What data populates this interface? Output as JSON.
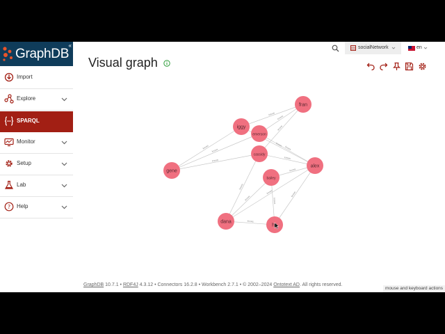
{
  "brand": {
    "name": "GraphDB"
  },
  "sidebar": {
    "items": [
      {
        "label": "Import",
        "icon": "import-icon",
        "has_chevron": false
      },
      {
        "label": "Explore",
        "icon": "explore-icon",
        "has_chevron": true
      },
      {
        "label": "SPARQL",
        "icon": "sparql-icon",
        "has_chevron": false,
        "active": true
      },
      {
        "label": "Monitor",
        "icon": "monitor-icon",
        "has_chevron": true
      },
      {
        "label": "Setup",
        "icon": "gear-icon",
        "has_chevron": true
      },
      {
        "label": "Lab",
        "icon": "flask-icon",
        "has_chevron": true
      },
      {
        "label": "Help",
        "icon": "help-icon",
        "has_chevron": true
      }
    ]
  },
  "header": {
    "title": "Visual graph",
    "repository": "socialNetwork",
    "language": "en"
  },
  "graph": {
    "node_color": "#f07080",
    "edge_color": "#c8c8c8",
    "nodes": [
      {
        "id": "fran",
        "label": "fran"
      },
      {
        "id": "iggy",
        "label": "iggy"
      },
      {
        "id": "emerson",
        "label": "emerson"
      },
      {
        "id": "cassidy",
        "label": "cassidy"
      },
      {
        "id": "gene",
        "label": "gene"
      },
      {
        "id": "alex",
        "label": "alex"
      },
      {
        "id": "bailey",
        "label": "bailey"
      },
      {
        "id": "dana",
        "label": "dana"
      },
      {
        "id": "harper",
        "label": "ha"
      }
    ],
    "edges": [
      {
        "source": "iggy",
        "target": "fran",
        "label": "knows"
      },
      {
        "source": "emerson",
        "target": "fran",
        "label": "knows"
      },
      {
        "source": "cassidy",
        "target": "fran",
        "label": "knows"
      },
      {
        "source": "gene",
        "target": "iggy",
        "label": "knows"
      },
      {
        "source": "gene",
        "target": "emerson",
        "label": "knows"
      },
      {
        "source": "gene",
        "target": "cassidy",
        "label": "knows"
      },
      {
        "source": "emerson",
        "target": "alex",
        "label": "knows"
      },
      {
        "source": "cassidy",
        "target": "alex",
        "label": "knows"
      },
      {
        "source": "iggy",
        "target": "alex",
        "label": "knows"
      },
      {
        "source": "bailey",
        "target": "alex",
        "label": "knows"
      },
      {
        "source": "cassidy",
        "target": "dana",
        "label": "knows"
      },
      {
        "source": "bailey",
        "target": "dana",
        "label": "knows"
      },
      {
        "source": "dana",
        "target": "harper",
        "label": "knows"
      },
      {
        "source": "alex",
        "target": "dana",
        "label": "knows"
      },
      {
        "source": "alex",
        "target": "harper",
        "label": "knows"
      },
      {
        "source": "bailey",
        "target": "harper",
        "label": "knows"
      }
    ]
  },
  "footer": {
    "graphdb_link": "GraphDB",
    "graphdb_version": " 10.7.1 • ",
    "rdf4j_link": "RDF4J",
    "rest": " 4.3.12 • Connectors 16.2.8 • Workbench 2.7.1 • © 2002–2024 ",
    "ontotext_link": "Ontotext AD",
    "rights": ". All rights reserved.",
    "mouse_keyboard": "mouse and keyboard actions"
  }
}
